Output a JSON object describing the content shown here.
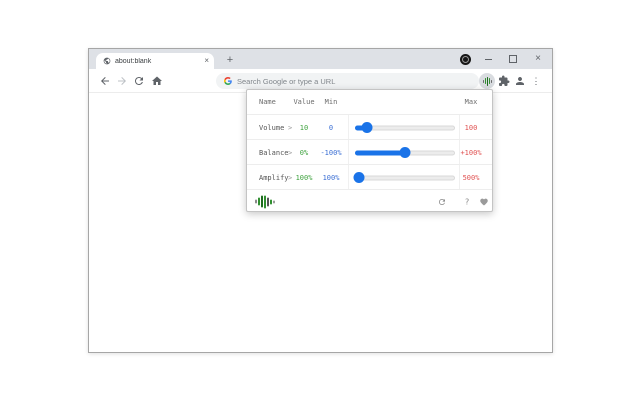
{
  "browser": {
    "tab_strip": {
      "active_tab": {
        "title": "about:blank",
        "close_glyph": "×"
      },
      "new_tab_glyph": "+"
    },
    "window_controls": {
      "close_glyph": "×"
    },
    "toolbar": {
      "omnibox_placeholder": "Search Google or type a URL",
      "menu_glyph": "⋮"
    }
  },
  "popup": {
    "columns": {
      "name": "Name",
      "value": "Value",
      "min": "Min",
      "max": "Max"
    },
    "chevron_glyph": ">",
    "rows": [
      {
        "name": "Volume",
        "value": "10",
        "min": "0",
        "max": "100",
        "slider_percent": 12
      },
      {
        "name": "Balance",
        "value": "0%",
        "min": "-100%",
        "max": "+100%",
        "slider_percent": 50
      },
      {
        "name": "Amplify",
        "value": "100%",
        "min": "100%",
        "max": "500%",
        "slider_percent": 4
      }
    ],
    "footer": {
      "help_glyph": "?"
    }
  },
  "colors": {
    "accent_blue": "#1a73e8",
    "value_green": "#3fa23f",
    "min_blue": "#3b6fd4",
    "max_red": "#e05252",
    "tabstrip_gray": "#dee1e6",
    "logo_green": "#2f8f2f"
  }
}
